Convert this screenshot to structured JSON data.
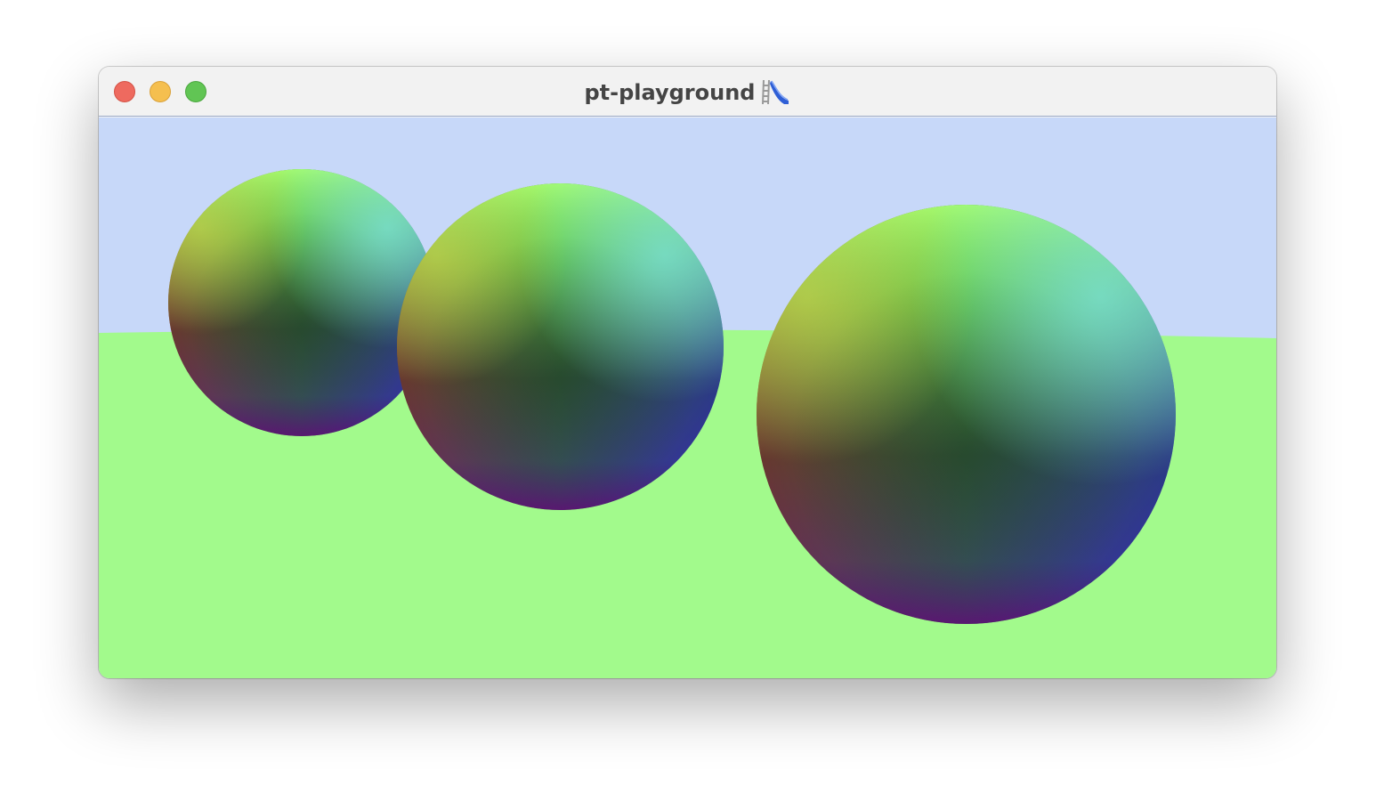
{
  "window": {
    "title": "pt-playground",
    "title_icon": "playground-slide-icon"
  },
  "colors": {
    "sky": "#c7d8f9",
    "ground": "#a2fa8c",
    "close": "#ee6a5f",
    "minimize": "#f5bf4f",
    "zoom": "#61c554"
  },
  "scene": {
    "render_mode": "surface-normals",
    "spheres": 3
  }
}
